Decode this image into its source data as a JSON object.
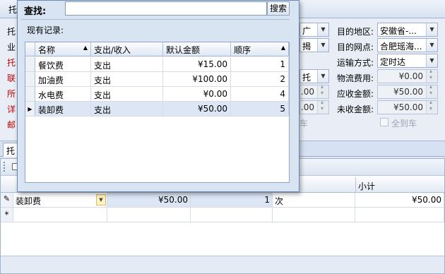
{
  "colors": {
    "accent": "#6d87b3",
    "selected_row": "#dce6f4",
    "required_label": "#c00000"
  },
  "background_form": {
    "header_glyph": "托",
    "left_labels": [
      {
        "text": "托",
        "red": false
      },
      {
        "text": "业",
        "red": false
      },
      {
        "text": "托",
        "red": true
      },
      {
        "text": "联",
        "red": true
      },
      {
        "text": "所",
        "red": true
      },
      {
        "text": "详",
        "red": true
      },
      {
        "text": "邮",
        "red": true
      }
    ],
    "partial_values": [
      "广",
      "揭",
      "托",
      ".00",
      ".00",
      "车"
    ],
    "right_fields": [
      {
        "label": "目的地区:",
        "value": "安徽省-...",
        "kind": "combo"
      },
      {
        "label": "目的网点:",
        "value": "合肥瑶海...",
        "kind": "combo"
      },
      {
        "label": "运输方式:",
        "value": "定时达",
        "kind": "combo"
      },
      {
        "label": "物流费用:",
        "value": "¥0.00",
        "kind": "number"
      },
      {
        "label": "应收金额:",
        "value": "¥50.00",
        "kind": "number"
      },
      {
        "label": "未收金额:",
        "value": "¥50.00",
        "kind": "number"
      }
    ],
    "full_car_checkbox": "全到车"
  },
  "tabs": {
    "first": "托"
  },
  "detail_grid": {
    "subtotal_header": "小计",
    "row": {
      "name": "装卸费",
      "amount": "¥50.00",
      "qty": "1",
      "unit": "次",
      "subtotal": "¥50.00"
    },
    "new_row_glyph": "*"
  },
  "popup": {
    "find_label": "查找:",
    "search_value": "",
    "search_button": "搜索",
    "records_label": "现有记录:",
    "columns": [
      "名称",
      "支出/收入",
      "默认金额",
      "顺序"
    ],
    "rows": [
      {
        "name": "餐饮费",
        "type": "支出",
        "amount": "¥15.00",
        "order": "1"
      },
      {
        "name": "加油费",
        "type": "支出",
        "amount": "¥100.00",
        "order": "2"
      },
      {
        "name": "水电费",
        "type": "支出",
        "amount": "¥0.00",
        "order": "4"
      },
      {
        "name": "装卸费",
        "type": "支出",
        "amount": "¥50.00",
        "order": "5"
      }
    ]
  }
}
